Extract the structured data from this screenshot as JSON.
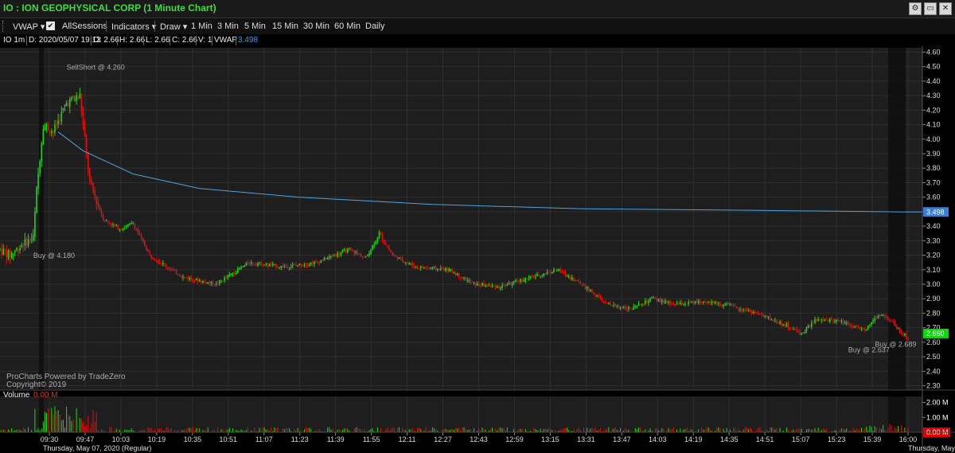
{
  "window": {
    "title": "IO : ION GEOPHYSICAL CORP (1 Minute Chart)",
    "gear_icon": "gear-icon",
    "restore_icon": "restore-icon",
    "close_icon": "close-icon"
  },
  "toolbar": {
    "vwap_label": "VWAP",
    "allsessions_label": "AllSessions",
    "allsessions_checked": true,
    "indicators_label": "Indicators",
    "draw_label": "Draw",
    "intervals": [
      "1 Min",
      "3 Min",
      "5 Min",
      "15 Min",
      "30 Min",
      "60 Min",
      "Daily"
    ]
  },
  "infobar": {
    "symbol": "IO 1m",
    "date": "D: 2020/05/07 19:13",
    "open": "O: 2.66",
    "high": "H: 2.66",
    "low": "L: 2.66",
    "close": "C: 2.66",
    "volume": "V: 1",
    "vwap_label": "VWAP",
    "vwap_value": "3.498"
  },
  "chart_data": {
    "type": "candlestick",
    "symbol": "IO",
    "interval": "1 Minute",
    "date_label": "Thursday, May 07, 2020 (Regular)",
    "date_label_right": "Thursday, May",
    "x_ticks": [
      "09:30",
      "09:47",
      "10:03",
      "10:19",
      "10:35",
      "10:51",
      "11:07",
      "11:23",
      "11:39",
      "11:55",
      "12:11",
      "12:27",
      "12:43",
      "12:59",
      "13:15",
      "13:31",
      "13:47",
      "14:03",
      "14:19",
      "14:35",
      "14:51",
      "15:07",
      "15:23",
      "15:39",
      "16:00"
    ],
    "y_ticks": [
      "4.60",
      "4.50",
      "4.40",
      "4.30",
      "4.20",
      "4.10",
      "4.00",
      "3.90",
      "3.80",
      "3.70",
      "3.60",
      "3.50",
      "3.40",
      "3.30",
      "3.20",
      "3.10",
      "3.00",
      "2.90",
      "2.80",
      "2.70",
      "2.60",
      "2.50",
      "2.40",
      "2.30"
    ],
    "ylim": [
      2.27,
      4.63
    ],
    "price_path": [
      {
        "x": 0,
        "y": 3.24
      },
      {
        "x": 6,
        "y": 3.2
      },
      {
        "x": 14,
        "y": 3.28
      },
      {
        "x": 20,
        "y": 3.32
      },
      {
        "x": 22,
        "y": 3.65
      },
      {
        "x": 26,
        "y": 4.1
      },
      {
        "x": 32,
        "y": 4.05
      },
      {
        "x": 40,
        "y": 4.25
      },
      {
        "x": 48,
        "y": 4.3
      },
      {
        "x": 54,
        "y": 3.7
      },
      {
        "x": 62,
        "y": 3.45
      },
      {
        "x": 72,
        "y": 3.38
      },
      {
        "x": 80,
        "y": 3.42
      },
      {
        "x": 90,
        "y": 3.2
      },
      {
        "x": 110,
        "y": 3.05
      },
      {
        "x": 130,
        "y": 3.0
      },
      {
        "x": 150,
        "y": 3.15
      },
      {
        "x": 170,
        "y": 3.12
      },
      {
        "x": 190,
        "y": 3.15
      },
      {
        "x": 210,
        "y": 3.24
      },
      {
        "x": 220,
        "y": 3.18
      },
      {
        "x": 228,
        "y": 3.35
      },
      {
        "x": 236,
        "y": 3.2
      },
      {
        "x": 250,
        "y": 3.12
      },
      {
        "x": 270,
        "y": 3.1
      },
      {
        "x": 285,
        "y": 3.0
      },
      {
        "x": 300,
        "y": 2.98
      },
      {
        "x": 320,
        "y": 3.05
      },
      {
        "x": 335,
        "y": 3.1
      },
      {
        "x": 350,
        "y": 3.0
      },
      {
        "x": 365,
        "y": 2.86
      },
      {
        "x": 380,
        "y": 2.83
      },
      {
        "x": 392,
        "y": 2.9
      },
      {
        "x": 405,
        "y": 2.86
      },
      {
        "x": 425,
        "y": 2.88
      },
      {
        "x": 440,
        "y": 2.85
      },
      {
        "x": 455,
        "y": 2.8
      },
      {
        "x": 470,
        "y": 2.73
      },
      {
        "x": 482,
        "y": 2.66
      },
      {
        "x": 490,
        "y": 2.75
      },
      {
        "x": 505,
        "y": 2.75
      },
      {
        "x": 520,
        "y": 2.68
      },
      {
        "x": 530,
        "y": 2.8
      },
      {
        "x": 540,
        "y": 2.7
      },
      {
        "x": 546,
        "y": 2.62
      }
    ],
    "x_max": 546,
    "vwap_path": [
      {
        "x": 35,
        "y": 4.05
      },
      {
        "x": 50,
        "y": 3.92
      },
      {
        "x": 80,
        "y": 3.76
      },
      {
        "x": 120,
        "y": 3.66
      },
      {
        "x": 180,
        "y": 3.6
      },
      {
        "x": 260,
        "y": 3.55
      },
      {
        "x": 350,
        "y": 3.52
      },
      {
        "x": 450,
        "y": 3.51
      },
      {
        "x": 546,
        "y": 3.498
      }
    ],
    "vwap_value": "3.498",
    "last_price": "2.660",
    "annotations": [
      {
        "text": "SellShort @ 4.260",
        "x": 40,
        "y": 4.48
      },
      {
        "text": "Buy @ 4.180",
        "x": 20,
        "y": 3.18
      },
      {
        "text": "Buy @ 2.689",
        "x": 526,
        "y": 2.57
      },
      {
        "text": "Buy @ 2.637",
        "x": 510,
        "y": 2.53
      }
    ],
    "watermark": [
      "ProCharts Powered by TradeZero",
      "Copyright© 2019"
    ],
    "volume": {
      "label": "Volume",
      "value": "0.00 M",
      "y_ticks": [
        "2.00 M",
        "1.00 M",
        "0.00 M"
      ],
      "ylim": [
        0,
        2.4
      ]
    }
  },
  "colors": {
    "up": "#16d916",
    "down": "#e01010",
    "vwap": "#4aa3e0",
    "label_green": "#0fd60f",
    "label_red": "#e00000",
    "label_blue": "#3a7fd5"
  }
}
